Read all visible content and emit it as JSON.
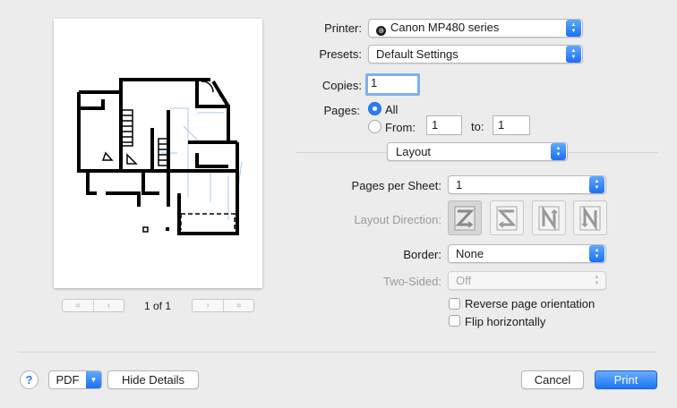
{
  "preview": {
    "page_indicator": "1 of 1",
    "nav": {
      "first": "«",
      "prev": "‹",
      "next": "›",
      "last": "»"
    }
  },
  "printer": {
    "label": "Printer:",
    "value": "Canon MP480 series",
    "icon": "printer-status-icon"
  },
  "presets": {
    "label": "Presets:",
    "value": "Default Settings"
  },
  "copies": {
    "label": "Copies:",
    "value": "1"
  },
  "pages": {
    "label": "Pages:",
    "all_label": "All",
    "from_label": "From:",
    "from_value": "1",
    "to_label": "to:",
    "to_value": "1",
    "selected": "All"
  },
  "section": {
    "value": "Layout"
  },
  "layout": {
    "pages_per_sheet": {
      "label": "Pages per Sheet:",
      "value": "1"
    },
    "layout_direction": {
      "label": "Layout Direction:",
      "options": [
        "z-left-right",
        "s-right-left",
        "n-top-bottom",
        "n-mirror"
      ]
    },
    "border": {
      "label": "Border:",
      "value": "None"
    },
    "two_sided": {
      "label": "Two-Sided:",
      "value": "Off"
    },
    "reverse": {
      "label": "Reverse page orientation",
      "checked": false
    },
    "flip": {
      "label": "Flip horizontally",
      "checked": false
    }
  },
  "footer": {
    "help": "?",
    "pdf": "PDF",
    "hide_details": "Hide Details",
    "cancel": "Cancel",
    "print": "Print"
  },
  "colors": {
    "accent": "#2e7cf6",
    "window": "#ececec"
  }
}
